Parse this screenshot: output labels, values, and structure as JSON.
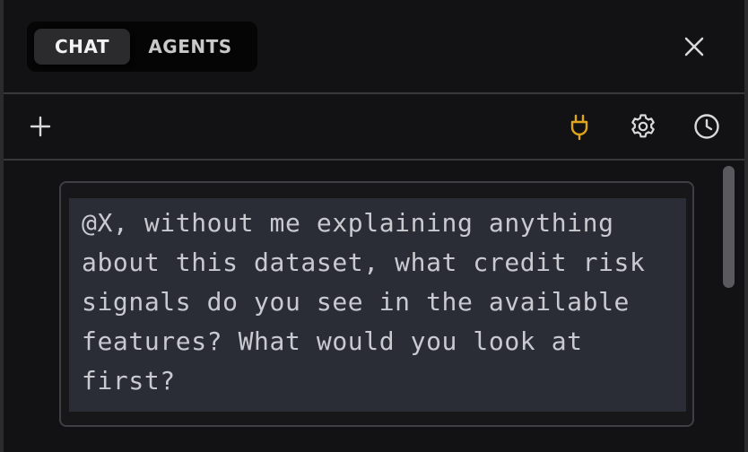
{
  "tabs": {
    "chat_label": "CHAT",
    "agents_label": "AGENTS",
    "active": "CHAT"
  },
  "header": {
    "close_icon": "close-icon"
  },
  "toolbar": {
    "new_chat_icon": "plus-icon",
    "plugin_icon": "plug-icon",
    "settings_icon": "gear-icon",
    "history_icon": "clock-icon",
    "plugin_color": "#e0a61a"
  },
  "message": {
    "text": "@X, without me explaining anything about this dataset, what credit risk signals do you see in the available features? What would you look at first?"
  },
  "colors": {
    "background": "#121214",
    "tab_active_bg": "#2b2b2e",
    "message_bg": "#2a2d36",
    "accent": "#e0a61a"
  }
}
